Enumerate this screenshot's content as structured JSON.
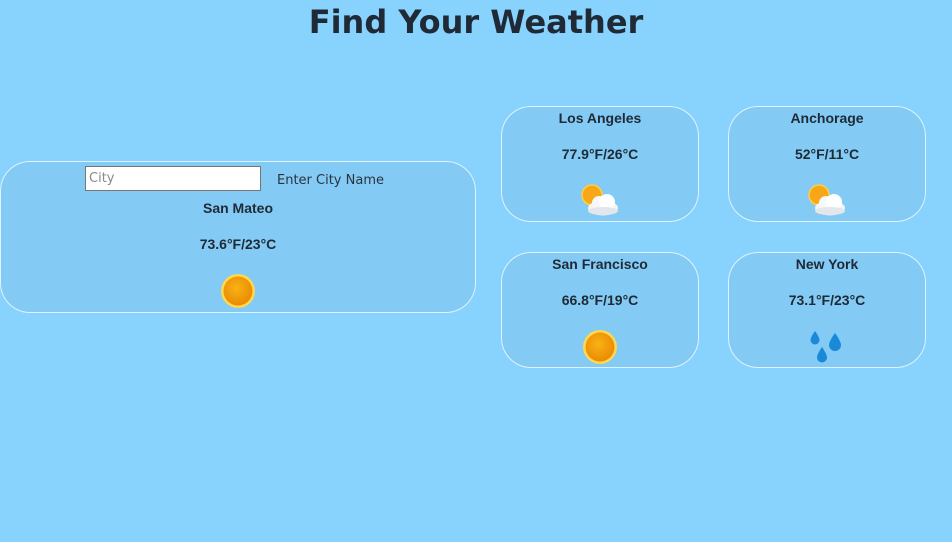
{
  "header": {
    "title": "Find Your Weather"
  },
  "search": {
    "placeholder": "City",
    "value": "",
    "label": "Enter City Name"
  },
  "main_card": {
    "city": "San Mateo",
    "temp": "73.6°F/23°C",
    "icon": "sun-icon"
  },
  "cards": [
    {
      "city": "Los Angeles",
      "temp": "77.9°F/26°C",
      "icon": "partly-cloudy-icon"
    },
    {
      "city": "Anchorage",
      "temp": "52°F/11°C",
      "icon": "partly-cloudy-icon"
    },
    {
      "city": "San Francisco",
      "temp": "66.8°F/19°C",
      "icon": "sun-icon"
    },
    {
      "city": "New York",
      "temp": "73.1°F/23°C",
      "icon": "rain-icon"
    }
  ],
  "colors": {
    "background": "#87d3fd",
    "card": "#80c2ed",
    "text": "#1f2a36",
    "sun": "#f39c12",
    "rain": "#1a8ad8"
  }
}
